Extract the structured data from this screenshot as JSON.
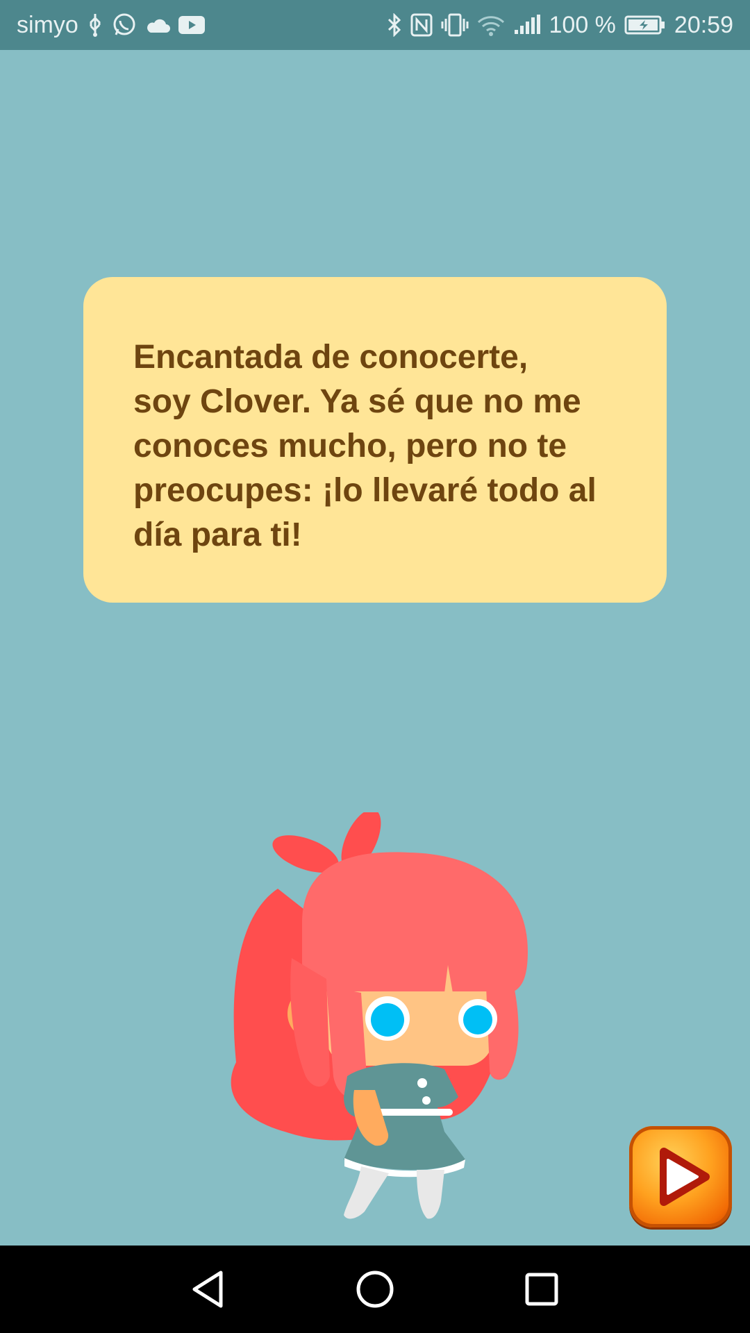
{
  "status_bar": {
    "carrier": "simyo",
    "battery": "100 %",
    "time": "20:59",
    "icons_left": [
      "usb-icon",
      "whatsapp-icon",
      "cloud-icon",
      "youtube-icon"
    ],
    "icons_right": [
      "bluetooth-icon",
      "nfc-icon",
      "vibrate-icon",
      "wifi-icon",
      "signal-icon",
      "battery-icon"
    ]
  },
  "dialog": {
    "lines": [
      "Encantada de conocerte,",
      "soy Clover. Ya sé que no me",
      "conoces mucho, pero no te",
      "preocupes: ¡lo llevaré todo al",
      "día para ti!"
    ]
  },
  "colors": {
    "background": "#87bec5",
    "status_bar": "#4d878d",
    "bubble": "#ffe597",
    "bubble_text": "#6e4510",
    "hair": "#ff6b6b",
    "dress": "#5f9595",
    "eyes": "#00bff5"
  },
  "navigation": {
    "icons": [
      "back-icon",
      "home-icon",
      "recents-icon"
    ]
  }
}
